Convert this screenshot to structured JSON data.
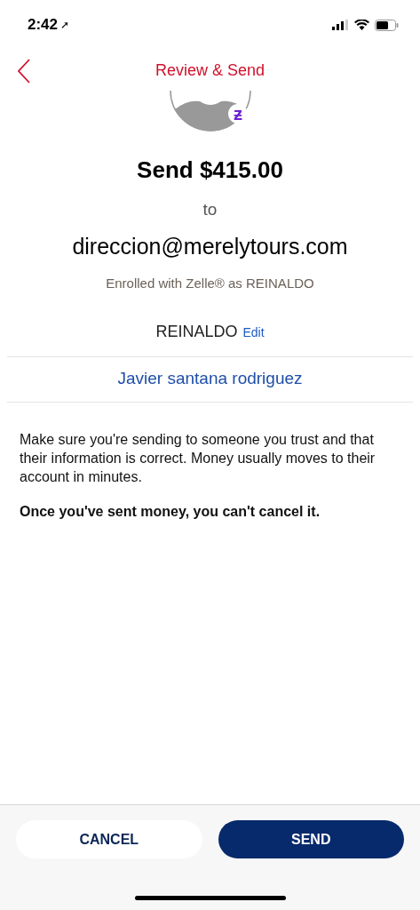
{
  "status_bar": {
    "time": "2:42",
    "location_arrow": "➚"
  },
  "header": {
    "title": "Review & Send"
  },
  "recipient": {
    "badge": "ƶ",
    "amount_line": "Send $415.00",
    "to": "to",
    "email": "direccion@merelytours.com",
    "enrolled": "Enrolled with Zelle® as REINALDO",
    "name": "REINALDO",
    "edit": "Edit",
    "account_name": "Javier santana rodriguez"
  },
  "notice": {
    "text": "Make sure you're sending to someone you trust and that their information is correct. Money usually moves to their account in minutes.",
    "warning": "Once you've sent money, you can't cancel it."
  },
  "buttons": [
    {
      "label": "CANCEL",
      "kind": "secondary"
    },
    {
      "label": "SEND",
      "kind": "primary"
    }
  ]
}
